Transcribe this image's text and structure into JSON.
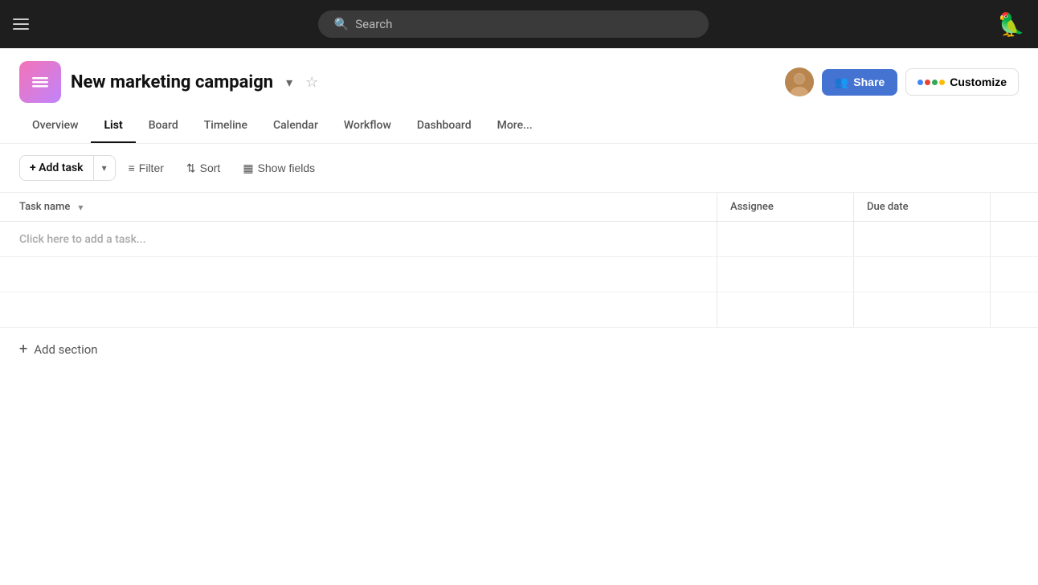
{
  "topnav": {
    "search_placeholder": "Search"
  },
  "header": {
    "project_name": "New marketing campaign",
    "share_label": "Share",
    "customize_label": "Customize",
    "dots": [
      {
        "color": "#4285F4"
      },
      {
        "color": "#EA4335"
      },
      {
        "color": "#34A853"
      },
      {
        "color": "#FBBC05"
      }
    ]
  },
  "tabs": [
    {
      "label": "Overview",
      "active": false
    },
    {
      "label": "List",
      "active": true
    },
    {
      "label": "Board",
      "active": false
    },
    {
      "label": "Timeline",
      "active": false
    },
    {
      "label": "Calendar",
      "active": false
    },
    {
      "label": "Workflow",
      "active": false
    },
    {
      "label": "Dashboard",
      "active": false
    },
    {
      "label": "More...",
      "active": false
    }
  ],
  "toolbar": {
    "add_task_label": "+ Add task",
    "filter_label": "Filter",
    "sort_label": "Sort",
    "show_fields_label": "Show fields"
  },
  "table": {
    "col_task": "Task name",
    "col_assignee": "Assignee",
    "col_duedate": "Due date",
    "empty_row_placeholder": "Click here to add a task..."
  },
  "add_section": {
    "label": "Add section"
  }
}
